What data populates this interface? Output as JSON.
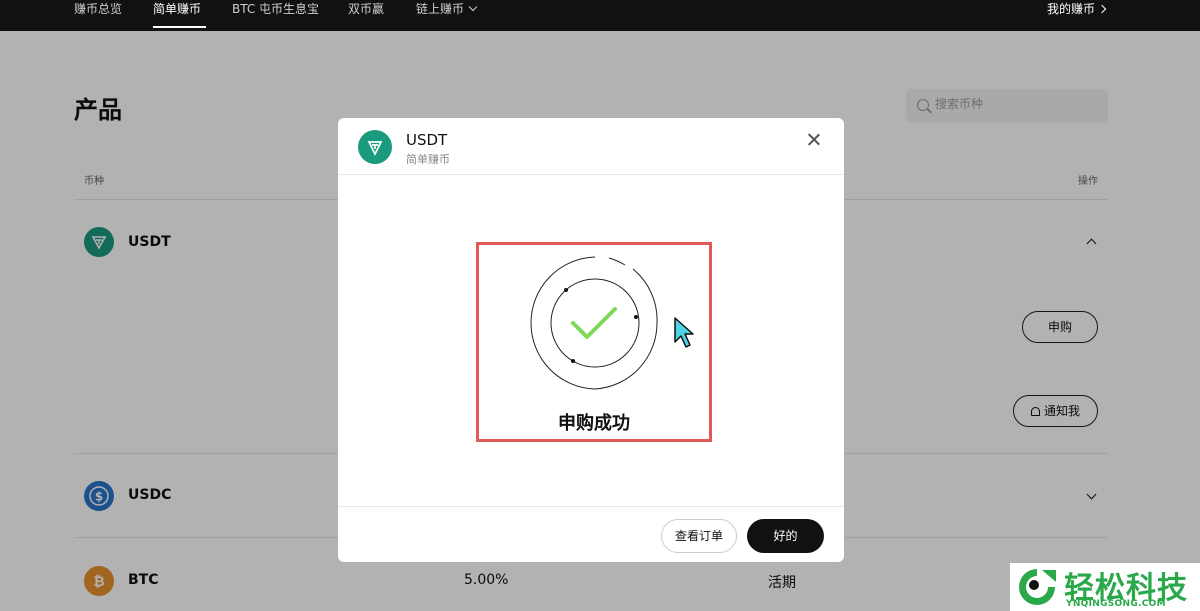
{
  "nav": {
    "items": [
      {
        "label": "赚币总览"
      },
      {
        "label": "简单赚币"
      },
      {
        "label": "BTC 屯币生息宝"
      },
      {
        "label": "双币赢"
      },
      {
        "label": "链上赚币"
      }
    ],
    "my_earn": "我的赚币"
  },
  "page": {
    "title": "产品",
    "search_placeholder": "搜索币种",
    "col_coin": "币种",
    "col_action": "操作"
  },
  "rows": [
    {
      "coin": "USDT",
      "icon": "tether-icon",
      "color": "#1a9a7f"
    },
    {
      "coin": "USDC",
      "icon": "usdc-icon",
      "color": "#2775ca"
    },
    {
      "coin": "BTC",
      "icon": "bitcoin-icon",
      "color": "#e8912d",
      "rate": "5.00%",
      "term": "活期"
    }
  ],
  "buttons": {
    "subscribe": "申购",
    "notify": "通知我"
  },
  "modal": {
    "coin": "USDT",
    "product": "简单赚币",
    "success_text": "申购成功",
    "view_order": "查看订单",
    "ok": "好的"
  },
  "watermark": {
    "brand": "轻松科技",
    "url": "YNQINGSONG.COM"
  },
  "colors": {
    "accent_green": "#7ed957",
    "highlight_red": "#e05a5a",
    "cursor_cyan": "#4fd1e6"
  }
}
